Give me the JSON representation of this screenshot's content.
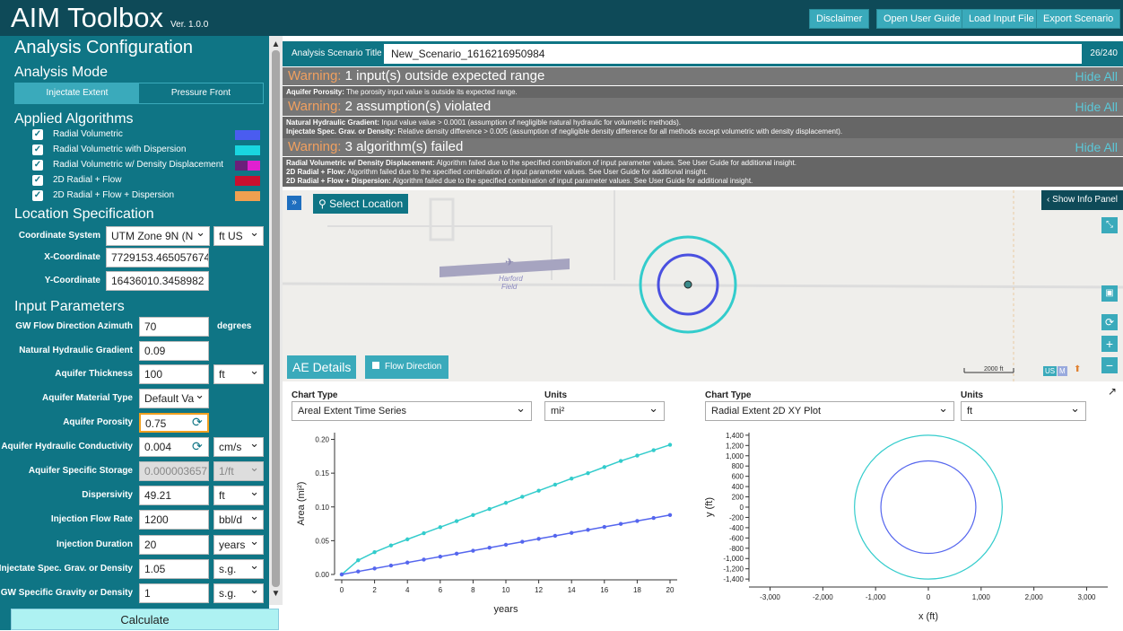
{
  "app": {
    "title": "AIM Toolbox",
    "version": "Ver. 1.0.0"
  },
  "header_buttons": [
    "Disclaimer",
    "Open User Guide",
    "Load Input File",
    "Export Scenario"
  ],
  "sidebar": {
    "title": "Analysis Configuration",
    "mode_title": "Analysis Mode",
    "modes": [
      "Injectate Extent",
      "Pressure Front"
    ],
    "alg_title": "Applied Algorithms",
    "algorithms": [
      {
        "label": "Radial Volumetric",
        "color": "#4a5cf0"
      },
      {
        "label": "Radial Volumetric with Dispersion",
        "color": "#19d6e0"
      },
      {
        "label": "Radial Volumetric w/ Density Displacement",
        "color": "#6b1f7a",
        "color2": "#e020d0"
      },
      {
        "label": "2D Radial + Flow",
        "color": "#c8102e"
      },
      {
        "label": "2D Radial + Flow + Dispersion",
        "color": "#f0a050"
      }
    ],
    "loc_title": "Location Specification",
    "coord_system_label": "Coordinate System",
    "coord_system_value": "UTM Zone 9N (N",
    "coord_unit": "ft US",
    "x_label": "X-Coordinate",
    "x_value": "7729153.465057674",
    "y_label": "Y-Coordinate",
    "y_value": "16436010.3458982",
    "params_title": "Input Parameters",
    "params": [
      {
        "label": "GW Flow Direction Azimuth",
        "value": "70",
        "unit": "degrees",
        "unit_type": "text"
      },
      {
        "label": "Natural Hydraulic Gradient",
        "value": "0.09",
        "unit": "",
        "unit_type": "none"
      },
      {
        "label": "Aquifer Thickness",
        "value": "100",
        "unit": "ft",
        "unit_type": "select"
      },
      {
        "label": "Aquifer Material Type",
        "value": "Default Va",
        "unit": "",
        "unit_type": "none"
      },
      {
        "label": "Aquifer Porosity",
        "value": "0.75",
        "unit": "",
        "unit_type": "none"
      },
      {
        "label": "Aquifer Hydraulic Conductivity",
        "value": "0.004",
        "unit": "cm/s",
        "unit_type": "select"
      },
      {
        "label": "Aquifer Specific Storage",
        "value": "0.000003657",
        "unit": "1/ft",
        "unit_type": "select"
      },
      {
        "label": "Dispersivity",
        "value": "49.21",
        "unit": "ft",
        "unit_type": "select"
      },
      {
        "label": "Injection Flow Rate",
        "value": "1200",
        "unit": "bbl/d",
        "unit_type": "select"
      },
      {
        "label": "Injection Duration",
        "value": "20",
        "unit": "years",
        "unit_type": "select"
      },
      {
        "label": "Injectate Spec. Grav. or Density",
        "value": "1.05",
        "unit": "s.g.",
        "unit_type": "select"
      },
      {
        "label": "GW Specific Gravity or Density",
        "value": "1",
        "unit": "s.g.",
        "unit_type": "select"
      }
    ],
    "calculate": "Calculate"
  },
  "scenario": {
    "label": "Analysis Scenario Title",
    "value": "New_Scenario_1616216950984",
    "count": "26/240"
  },
  "warnings": [
    {
      "prefix": "Warning:",
      "text": "1 input(s) outside expected range",
      "hide": "Hide All",
      "details": [
        {
          "key": "Aquifer Porosity:",
          "text": "The porosity input value is outside its expected range."
        }
      ]
    },
    {
      "prefix": "Warning:",
      "text": "2 assumption(s) violated",
      "hide": "Hide All",
      "details": [
        {
          "key": "Natural Hydraulic Gradient:",
          "text": "Input value value > 0.0001 (assumption of negligible natural hydraulic for volumetric methods)."
        },
        {
          "key": "Injectate Spec. Grav. or Density:",
          "text": "Relative density difference > 0.005 (assumption of negligible density difference for all methods except volumetric with density displacement)."
        }
      ]
    },
    {
      "prefix": "Warning:",
      "text": "3 algorithm(s) failed",
      "hide": "Hide All",
      "details": [
        {
          "key": "Radial Volumetric w/ Density Displacement:",
          "text": "Algorithm failed due to the specified combination of input parameter values.  See User Guide for additional insight."
        },
        {
          "key": "2D Radial + Flow:",
          "text": "Algorithm failed due to the specified combination of input parameter values.  See User Guide for additional insight."
        },
        {
          "key": "2D Radial + Flow + Dispersion:",
          "text": "Algorithm failed due to the specified combination of input parameter values.  See User Guide for additional insight."
        }
      ]
    }
  ],
  "map": {
    "expand": "»",
    "select_location": "Select Location",
    "show_info": "Show Info Panel",
    "airfield": "Harford\nField",
    "airfield_line1": "Harford",
    "airfield_line2": "Field",
    "ae_details": "AE Details",
    "flow_direction": "Flow Direction",
    "scale": "2000 ft",
    "us": "US",
    "m": "M"
  },
  "chart_left": {
    "type_label": "Chart Type",
    "type_value": "Areal Extent Time Series",
    "units_label": "Units",
    "units_value": "mi²"
  },
  "chart_right": {
    "type_label": "Chart Type",
    "type_value": "Radial Extent 2D XY Plot",
    "units_label": "Units",
    "units_value": "ft"
  },
  "chart_data": [
    {
      "type": "line",
      "xlabel": "years",
      "ylabel": "Area (mi²)",
      "xlim": [
        0,
        20
      ],
      "ylim": [
        0,
        0.21
      ],
      "xticks": [
        0,
        2,
        4,
        6,
        8,
        10,
        12,
        14,
        16,
        18,
        20
      ],
      "yticks": [
        "0.00",
        "0.05",
        "0.10",
        "0.15",
        "0.20"
      ],
      "x": [
        0,
        1,
        2,
        3,
        4,
        5,
        6,
        7,
        8,
        9,
        10,
        11,
        12,
        13,
        14,
        15,
        16,
        17,
        18,
        19,
        20
      ],
      "series": [
        {
          "color": "#33cccc",
          "values": [
            0,
            0.021,
            0.033,
            0.043,
            0.052,
            0.061,
            0.07,
            0.079,
            0.088,
            0.097,
            0.106,
            0.115,
            0.124,
            0.133,
            0.142,
            0.15,
            0.159,
            0.168,
            0.176,
            0.184,
            0.192
          ]
        },
        {
          "color": "#5566ee",
          "values": [
            0,
            0.0044,
            0.0088,
            0.0132,
            0.0176,
            0.022,
            0.0264,
            0.0308,
            0.0352,
            0.0396,
            0.044,
            0.0484,
            0.0528,
            0.0572,
            0.0616,
            0.066,
            0.0704,
            0.0748,
            0.0792,
            0.0836,
            0.088
          ]
        }
      ]
    },
    {
      "type": "scatter",
      "xlabel": "x (ft)",
      "ylabel": "y (ft)",
      "xlim": [
        -3400,
        3400
      ],
      "ylim": [
        -1450,
        1450
      ],
      "xticks": [
        "-3,000",
        "-2,000",
        "-1,000",
        "0",
        "1,000",
        "2,000",
        "3,000"
      ],
      "yticks": [
        "1,400",
        "1,200",
        "1,000",
        "800",
        "600",
        "400",
        "200",
        "0",
        "-200",
        "-400",
        "-600",
        "-800",
        "-1,000",
        "-1,200",
        "-1,400"
      ],
      "series": [
        {
          "color": "#33cccc",
          "shape": "circle",
          "radius": 1400
        },
        {
          "color": "#5566ee",
          "shape": "circle",
          "radius": 900
        }
      ]
    }
  ]
}
